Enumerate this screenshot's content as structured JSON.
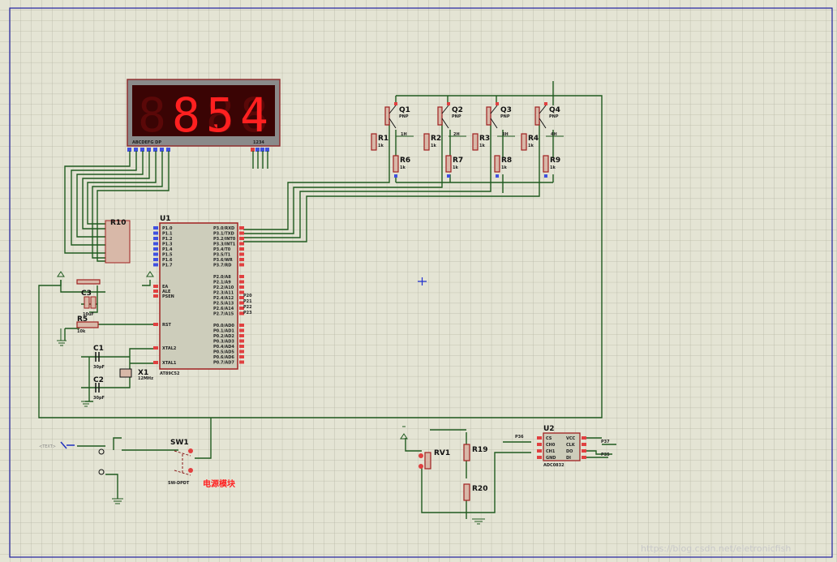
{
  "display": {
    "digits": [
      "",
      "8.",
      "5",
      "4"
    ],
    "segment_label": "ABCDEFG  DP",
    "digit_label": "1234",
    "lit_color": "#ff2020",
    "dim_color": "#5a0808"
  },
  "u1": {
    "ref": "U1",
    "part": "AT89C52",
    "left_pins": [
      "P1.0",
      "P1.1",
      "P1.2",
      "P1.3",
      "P1.4",
      "P1.5",
      "P1.6",
      "P1.7"
    ],
    "left_mid_pins": [
      "EA",
      "ALE",
      "PSEN"
    ],
    "rst": "RST",
    "xtal2": "XTAL2",
    "xtal1": "XTAL1",
    "right_pins_a": [
      "P3.0/RXD",
      "P3.1/TXD",
      "P3.2/INT0",
      "P3.3/INT1",
      "P3.4/T0",
      "P3.5/T1",
      "P3.6/WR",
      "P3.7/RD"
    ],
    "right_pins_b": [
      "P2.0/A8",
      "P2.1/A9",
      "P2.2/A10",
      "P2.3/A11",
      "P2.4/A12",
      "P2.5/A13",
      "P2.6/A14",
      "P2.7/A15"
    ],
    "right_pins_c": [
      "P0.0/AD0",
      "P0.1/AD1",
      "P0.2/AD2",
      "P0.3/AD3",
      "P0.4/AD4",
      "P0.5/AD5",
      "P0.6/AD6",
      "P0.7/AD7"
    ],
    "net_labels": [
      "P20",
      "P21",
      "P22",
      "P23"
    ]
  },
  "r10": {
    "ref": "R10"
  },
  "transistors": [
    {
      "ref": "Q1",
      "type": "PNP"
    },
    {
      "ref": "Q2",
      "type": "PNP"
    },
    {
      "ref": "Q3",
      "type": "PNP"
    },
    {
      "ref": "Q4",
      "type": "PNP"
    }
  ],
  "base_resistors": [
    "R1",
    "R2",
    "R3",
    "R4"
  ],
  "pull_resistors": [
    "R6",
    "R7",
    "R8",
    "R9"
  ],
  "resistor_value": "1k",
  "digit_nets": [
    "1H",
    "2H",
    "3H",
    "4H"
  ],
  "reset": {
    "c3": "C3",
    "r5": "R5",
    "c3_value": "10uF",
    "r5_value": "10k"
  },
  "crystal": {
    "c1": "C1",
    "c2": "C2",
    "x1": "X1",
    "cap_value": "30pF",
    "x1_value": "12MHz"
  },
  "switch": {
    "ref": "SW1",
    "part": "SW-DPDT",
    "module_label": "电源模块"
  },
  "adc": {
    "rv1": "RV1",
    "r19": "R19",
    "r20": "R20",
    "u2": "U2",
    "u2_part": "ADC0832",
    "pins_left": [
      "CS",
      "CH0",
      "CH1",
      "GND"
    ],
    "pins_right": [
      "VCC",
      "CLK",
      "DO",
      "DI"
    ],
    "net_labels": [
      "P36",
      "P37",
      "P35"
    ]
  },
  "text_placeholder": "<TEXT>",
  "watermark": "https://blog.csdn.net/eletronicfish"
}
